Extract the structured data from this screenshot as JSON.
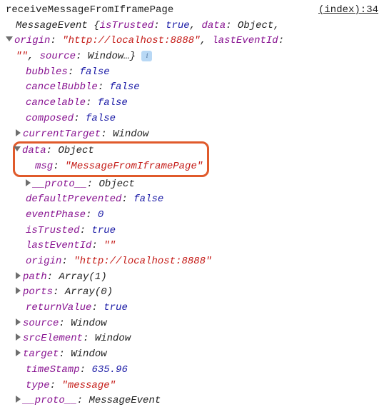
{
  "header": {
    "fn": "receiveMessageFromIframePage",
    "src": "(index):34"
  },
  "summary": {
    "class": "MessageEvent",
    "isTrustedKey": "isTrusted",
    "isTrustedVal": "true",
    "dataKey": "data",
    "dataVal": "Object",
    "originKey": "origin",
    "originVal": "\"http://localhost:8888\"",
    "lastEventIdKey": "lastEventId",
    "lastEventIdVal": "\"\"",
    "sourceKey": "source",
    "sourceVal": "Window…"
  },
  "props": {
    "bubbles": {
      "k": "bubbles",
      "v": "false"
    },
    "cancelBubble": {
      "k": "cancelBubble",
      "v": "false"
    },
    "cancelable": {
      "k": "cancelable",
      "v": "false"
    },
    "composed": {
      "k": "composed",
      "v": "false"
    },
    "currentTarget": {
      "k": "currentTarget",
      "v": "Window"
    },
    "data": {
      "k": "data",
      "v": "Object",
      "msg": {
        "k": "msg",
        "v": "\"MessageFromIframePage\""
      },
      "proto": {
        "k": "__proto__",
        "v": "Object"
      }
    },
    "defaultPrevented": {
      "k": "defaultPrevented",
      "v": "false"
    },
    "eventPhase": {
      "k": "eventPhase",
      "v": "0"
    },
    "isTrusted": {
      "k": "isTrusted",
      "v": "true"
    },
    "lastEventId": {
      "k": "lastEventId",
      "v": "\"\""
    },
    "origin": {
      "k": "origin",
      "v": "\"http://localhost:8888\""
    },
    "path": {
      "k": "path",
      "v": "Array(1)"
    },
    "ports": {
      "k": "ports",
      "v": "Array(0)"
    },
    "returnValue": {
      "k": "returnValue",
      "v": "true"
    },
    "source": {
      "k": "source",
      "v": "Window"
    },
    "srcElement": {
      "k": "srcElement",
      "v": "Window"
    },
    "target": {
      "k": "target",
      "v": "Window"
    },
    "timeStamp": {
      "k": "timeStamp",
      "v": "635.96"
    },
    "type": {
      "k": "type",
      "v": "\"message\""
    },
    "proto": {
      "k": "__proto__",
      "v": "MessageEvent"
    }
  }
}
